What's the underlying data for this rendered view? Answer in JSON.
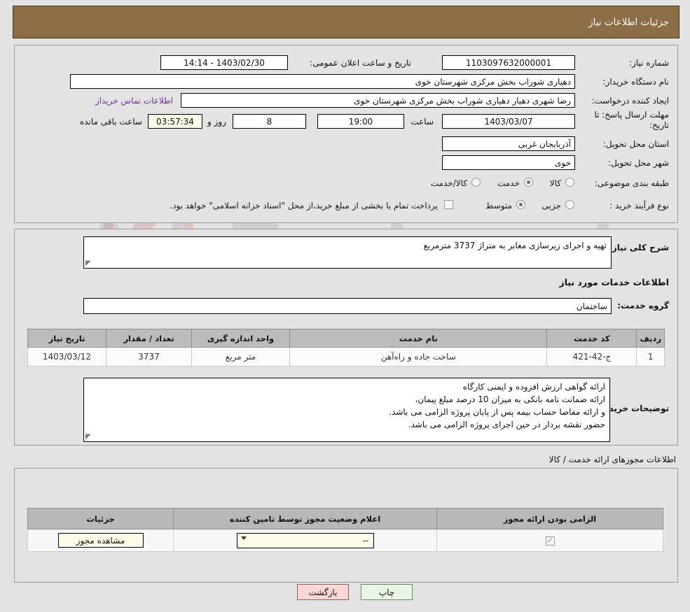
{
  "header": {
    "title": "جزئیات اطلاعات نیاز"
  },
  "watermark": {
    "text": "AriaTender.net"
  },
  "colors": {
    "header_bg": "#8b6d46",
    "page_bg": "#e3e3e3",
    "link": "#7030a0",
    "table_header": "#bcbcbc",
    "print_btn": "#e9f6e4",
    "back_btn": "#fbd6d6",
    "field_cream": "#fbfbe8"
  },
  "summary": {
    "need_number_label": "شماره نیاز:",
    "need_number_value": "1103097632000001",
    "announce_label": "تاریخ و ساعت اعلان عمومی:",
    "announce_value": "1403/02/30 - 14:14",
    "buyer_org_label": "نام دستگاه خریدار:",
    "buyer_org_value": "دهیاری شوراب بخش مرکزی شهرستان خوی",
    "creator_label": "ایجاد کننده درخواست:",
    "creator_value": "رضا شهری دهیار دهیاری شوراب بخش مرکزی شهرستان خوی",
    "contact_link": "اطلاعات تماس خریدار",
    "deadline_label": "مهلت ارسال پاسخ: تا تاریخ:",
    "deadline_date": "1403/03/07",
    "deadline_time_label": "ساعت",
    "deadline_time": "19:00",
    "remaining_days": "8",
    "remaining_days_label": "روز و",
    "remaining_clock": "03:57:34",
    "remaining_clock_label": "ساعت باقی مانده",
    "province_label": "استان محل تحویل:",
    "province_value": "آذربایجان غربی",
    "city_label": "شهر محل تحویل:",
    "city_value": "خوی",
    "category_label": "طبقه بندی موضوعی:",
    "category_options": [
      {
        "label": "کالا",
        "selected": false
      },
      {
        "label": "خدمت",
        "selected": true
      },
      {
        "label": "کالا/خدمت",
        "selected": false
      }
    ],
    "process_label": "نوع فرآیند خرید :",
    "process_options": [
      {
        "label": "جزیی",
        "selected": false
      },
      {
        "label": "متوسط",
        "selected": true
      }
    ],
    "treasury_checkbox_checked": false,
    "treasury_note": "پرداخت تمام یا بخشی از مبلغ خرید،از محل \"اسناد خزانه اسلامی\" خواهد بود."
  },
  "need_desc": {
    "label": "شرح کلی نیاز:",
    "value": "تهیه و اجرای زیرسازی معابر به متراژ 3737 مترمربع"
  },
  "services": {
    "section_title": "اطلاعات خدمات مورد نیاز",
    "group_label": "گروه خدمت:",
    "group_value": "ساختمان",
    "columns": [
      "ردیف",
      "کد خدمت",
      "نام خدمت",
      "واحد اندازه گیری",
      "تعداد / مقدار",
      "تاریخ نیاز"
    ],
    "rows": [
      {
        "row": "1",
        "code": "ج-42-421",
        "name": "ساخت جاده و راه‌آهن",
        "unit": "متر مربع",
        "quantity": "3737",
        "date": "1403/03/12"
      }
    ]
  },
  "buyer_notes": {
    "label": "توضیحات خریدار:",
    "lines": [
      "ارائه گواهی ارزش افزوده و ایمنی کارگاه",
      "ارائه ضمانت نامه بانکی به میزان 10 درصد مبلغ پیمان،",
      "و ارائه مفاصا حساب بیمه پس از پایان پروژه الزامی می باشد.",
      "حضور نقشه بردار در حین اجرای پروژه الزامی می باشد."
    ]
  },
  "permits": {
    "section_title": "اطلاعات مجوزهای ارائه خدمت / کالا",
    "columns": [
      "الزامی بودن ارائه مجوز",
      "اعلام وضعیت مجوز توسط تامین کننده",
      "جزئیات"
    ],
    "rows": [
      {
        "required_checked": true,
        "status_value": "--",
        "details_button": "مشاهده مجوز"
      }
    ]
  },
  "footer": {
    "print_label": "چاپ",
    "back_label": "بازگشت"
  }
}
